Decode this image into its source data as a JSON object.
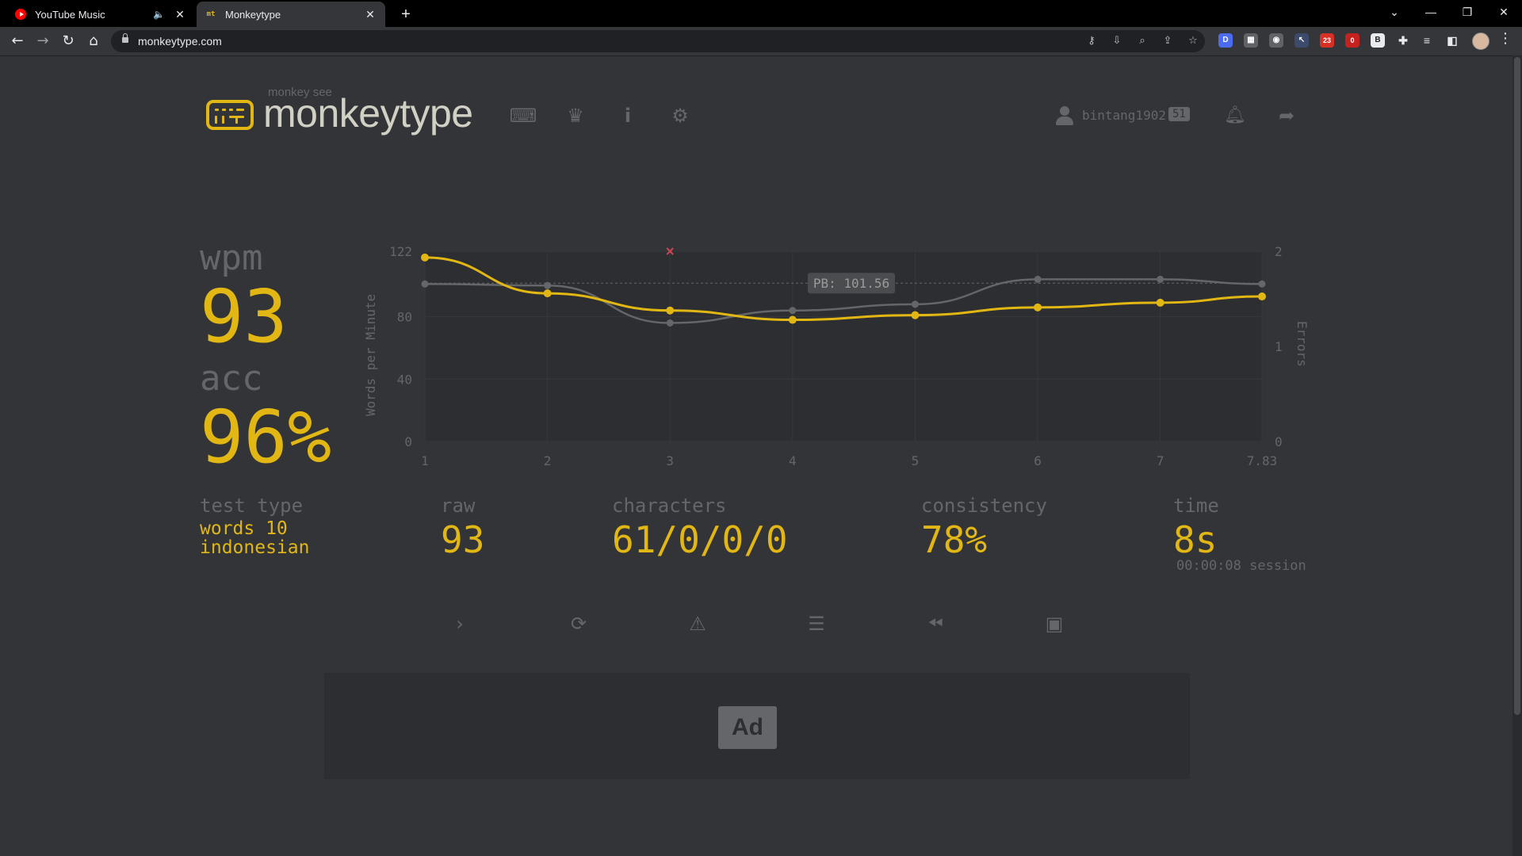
{
  "browser": {
    "tabs": [
      {
        "title": "YouTube Music",
        "active": false
      },
      {
        "title": "Monkeytype",
        "active": true
      }
    ],
    "url": "monkeytype.com",
    "extension_badges": [
      "D",
      "23",
      "0",
      "B"
    ]
  },
  "header": {
    "logo_small": "monkey see",
    "logo_text": "monkeytype",
    "nav_icons": [
      "keyboard-icon",
      "crown-icon",
      "info-icon",
      "gear-icon"
    ],
    "username": "bintang1902",
    "level": "51"
  },
  "result": {
    "wpm_label": "wpm",
    "wpm": "93",
    "acc_label": "acc",
    "acc": "96%",
    "test_type_label": "test type",
    "test_type_line1": "words 10",
    "test_type_line2": "indonesian",
    "raw_label": "raw",
    "raw": "93",
    "characters_label": "characters",
    "characters": "61/0/0/0",
    "consistency_label": "consistency",
    "consistency": "78%",
    "time_label": "time",
    "time": "8s",
    "session": "00:00:08 session"
  },
  "actions": [
    "next-test-icon",
    "restart-icon",
    "report-icon",
    "words-history-icon",
    "replay-icon",
    "screenshot-icon"
  ],
  "ad": {
    "label": "Ad"
  },
  "colors": {
    "main": "#e2b714",
    "sub": "#646669",
    "bg": "#323437",
    "text": "#d1d0c5",
    "error": "#ca4754"
  },
  "chart_data": {
    "type": "line",
    "x": [
      1,
      2,
      3,
      4,
      5,
      6,
      7,
      7.83
    ],
    "x_tick_labels": [
      "1",
      "2",
      "3",
      "4",
      "5",
      "6",
      "7",
      "7.83"
    ],
    "ylabel": "Words per Minute",
    "y2label": "Errors",
    "ylim": [
      0,
      122
    ],
    "y_ticks": [
      "0",
      "40",
      "80",
      "122"
    ],
    "y2lim": [
      0,
      2
    ],
    "y2_ticks": [
      "0",
      "1",
      "2"
    ],
    "series": [
      {
        "name": "wpm",
        "color": "#e2b714",
        "values": [
          118,
          95,
          84,
          78,
          81,
          86,
          89,
          93
        ]
      },
      {
        "name": "raw",
        "color": "#646669",
        "values": [
          101,
          100,
          76,
          84,
          88,
          104,
          104,
          101
        ]
      }
    ],
    "errors": [
      {
        "x": 3,
        "count": 2
      }
    ],
    "pb_line": {
      "value": 101.56,
      "label": "PB: 101.56"
    },
    "grid": true
  }
}
